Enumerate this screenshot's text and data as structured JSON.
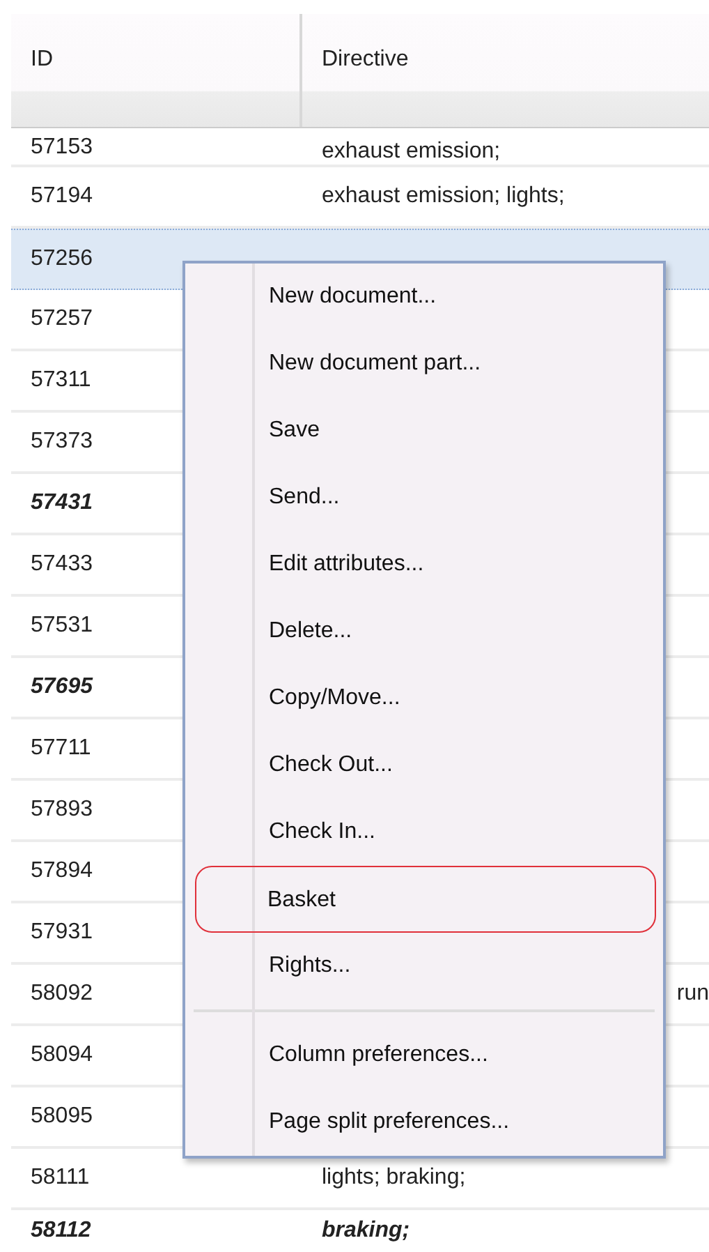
{
  "table": {
    "columns": [
      "ID",
      "Directive"
    ],
    "rows": [
      {
        "id": "57153",
        "directive": "exhaust emission;",
        "selected": false,
        "bold": false
      },
      {
        "id": "57194",
        "directive": "exhaust emission; lights;",
        "selected": false,
        "bold": false
      },
      {
        "id": "57256",
        "selected": true,
        "bold": false
      },
      {
        "id": "57257",
        "selected": false,
        "bold": false
      },
      {
        "id": "57311",
        "selected": false,
        "bold": false
      },
      {
        "id": "57373",
        "selected": false,
        "bold": false
      },
      {
        "id": "57431",
        "selected": false,
        "bold": true
      },
      {
        "id": "57433",
        "selected": false,
        "bold": false
      },
      {
        "id": "57531",
        "selected": false,
        "bold": false
      },
      {
        "id": "57695",
        "selected": false,
        "bold": true
      },
      {
        "id": "57711",
        "selected": false,
        "bold": false
      },
      {
        "id": "57893",
        "selected": false,
        "bold": false
      },
      {
        "id": "57894",
        "selected": false,
        "bold": false
      },
      {
        "id": "57931",
        "selected": false,
        "bold": false
      },
      {
        "id": "58092",
        "directive_tail": "run",
        "selected": false,
        "bold": false
      },
      {
        "id": "58094",
        "selected": false,
        "bold": false
      },
      {
        "id": "58095",
        "selected": false,
        "bold": false
      },
      {
        "id": "58111",
        "directive": "lights; braking;",
        "selected": false,
        "bold": false
      },
      {
        "id": "58112",
        "directive": "braking;",
        "selected": false,
        "bold": true
      }
    ]
  },
  "context_menu": {
    "items": [
      {
        "kind": "item",
        "label": "New document...",
        "circled": false
      },
      {
        "kind": "item",
        "label": "New document part...",
        "circled": false
      },
      {
        "kind": "item",
        "label": "Save",
        "circled": false
      },
      {
        "kind": "item",
        "label": "Send...",
        "circled": false
      },
      {
        "kind": "item",
        "label": "Edit attributes...",
        "circled": false
      },
      {
        "kind": "item",
        "label": "Delete...",
        "circled": false
      },
      {
        "kind": "item",
        "label": "Copy/Move...",
        "circled": false
      },
      {
        "kind": "item",
        "label": "Check Out...",
        "circled": false
      },
      {
        "kind": "item",
        "label": "Check In...",
        "circled": false
      },
      {
        "kind": "item",
        "label": "Basket",
        "circled": true
      },
      {
        "kind": "item",
        "label": "Rights...",
        "circled": false
      },
      {
        "kind": "separator"
      },
      {
        "kind": "item",
        "label": "Column preferences...",
        "circled": false
      },
      {
        "kind": "item",
        "label": "Page split preferences...",
        "circled": false
      }
    ]
  }
}
